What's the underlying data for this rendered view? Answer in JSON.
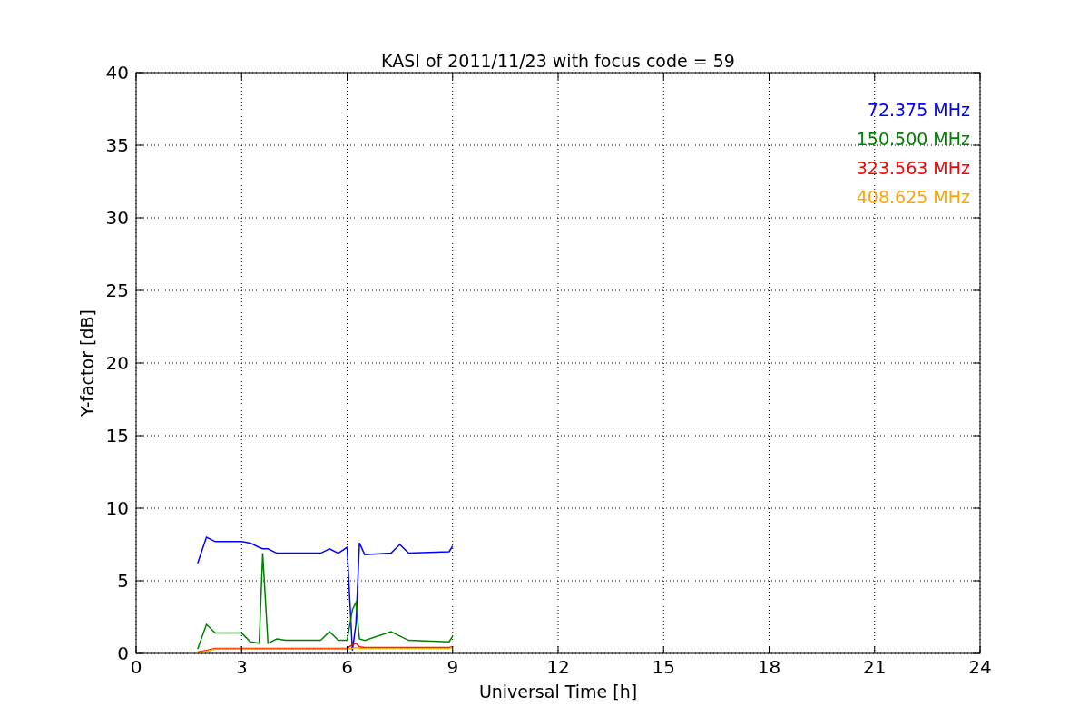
{
  "chart": {
    "chart_data": {
      "type": "line",
      "title": "KASI of 2011/11/23 with focus code = 59",
      "xlabel": "Universal Time [h]",
      "ylabel": "Y-factor [dB]",
      "x": [
        1.75,
        2.0,
        2.25,
        3.0,
        3.25,
        3.5,
        3.6,
        3.75,
        4.0,
        4.25,
        5.25,
        5.5,
        5.75,
        6.0,
        6.15,
        6.25,
        6.35,
        6.5,
        7.25,
        7.5,
        7.75,
        8.9,
        9.0
      ],
      "series": [
        {
          "name": "72.375 MHz",
          "color": "#0000ff",
          "values": [
            6.2,
            8.0,
            7.7,
            7.7,
            7.6,
            7.3,
            7.2,
            7.2,
            6.9,
            6.9,
            6.9,
            7.2,
            6.9,
            7.3,
            0.2,
            2.0,
            7.6,
            6.8,
            6.9,
            7.5,
            6.9,
            7.0,
            7.4
          ]
        },
        {
          "name": "150.500 MHz",
          "color": "#008000",
          "values": [
            0.3,
            2.0,
            1.4,
            1.4,
            0.8,
            0.7,
            6.9,
            0.7,
            1.0,
            0.9,
            0.9,
            1.5,
            0.9,
            0.9,
            3.0,
            3.5,
            1.0,
            0.9,
            1.5,
            1.2,
            0.9,
            0.8,
            1.2
          ]
        },
        {
          "name": "323.563 MHz",
          "color": "#ff0000",
          "values": [
            0.1,
            0.2,
            0.35,
            0.35,
            0.35,
            0.35,
            0.35,
            0.35,
            0.35,
            0.35,
            0.35,
            0.35,
            0.35,
            0.35,
            0.6,
            0.7,
            0.45,
            0.4,
            0.4,
            0.4,
            0.4,
            0.4,
            0.45
          ]
        },
        {
          "name": "408.625 MHz",
          "color": "#ffa500",
          "values": [
            0.05,
            0.15,
            0.3,
            0.3,
            0.3,
            0.3,
            0.3,
            0.3,
            0.3,
            0.3,
            0.3,
            0.3,
            0.3,
            0.3,
            0.35,
            0.4,
            0.35,
            0.35,
            0.35,
            0.35,
            0.35,
            0.35,
            0.4
          ]
        }
      ],
      "xlim": [
        0,
        24
      ],
      "ylim": [
        0,
        40
      ],
      "xticks": [
        0,
        3,
        6,
        9,
        12,
        15,
        18,
        21,
        24
      ],
      "yticks": [
        0,
        5,
        10,
        15,
        20,
        25,
        30,
        35,
        40
      ],
      "grid": true
    }
  }
}
